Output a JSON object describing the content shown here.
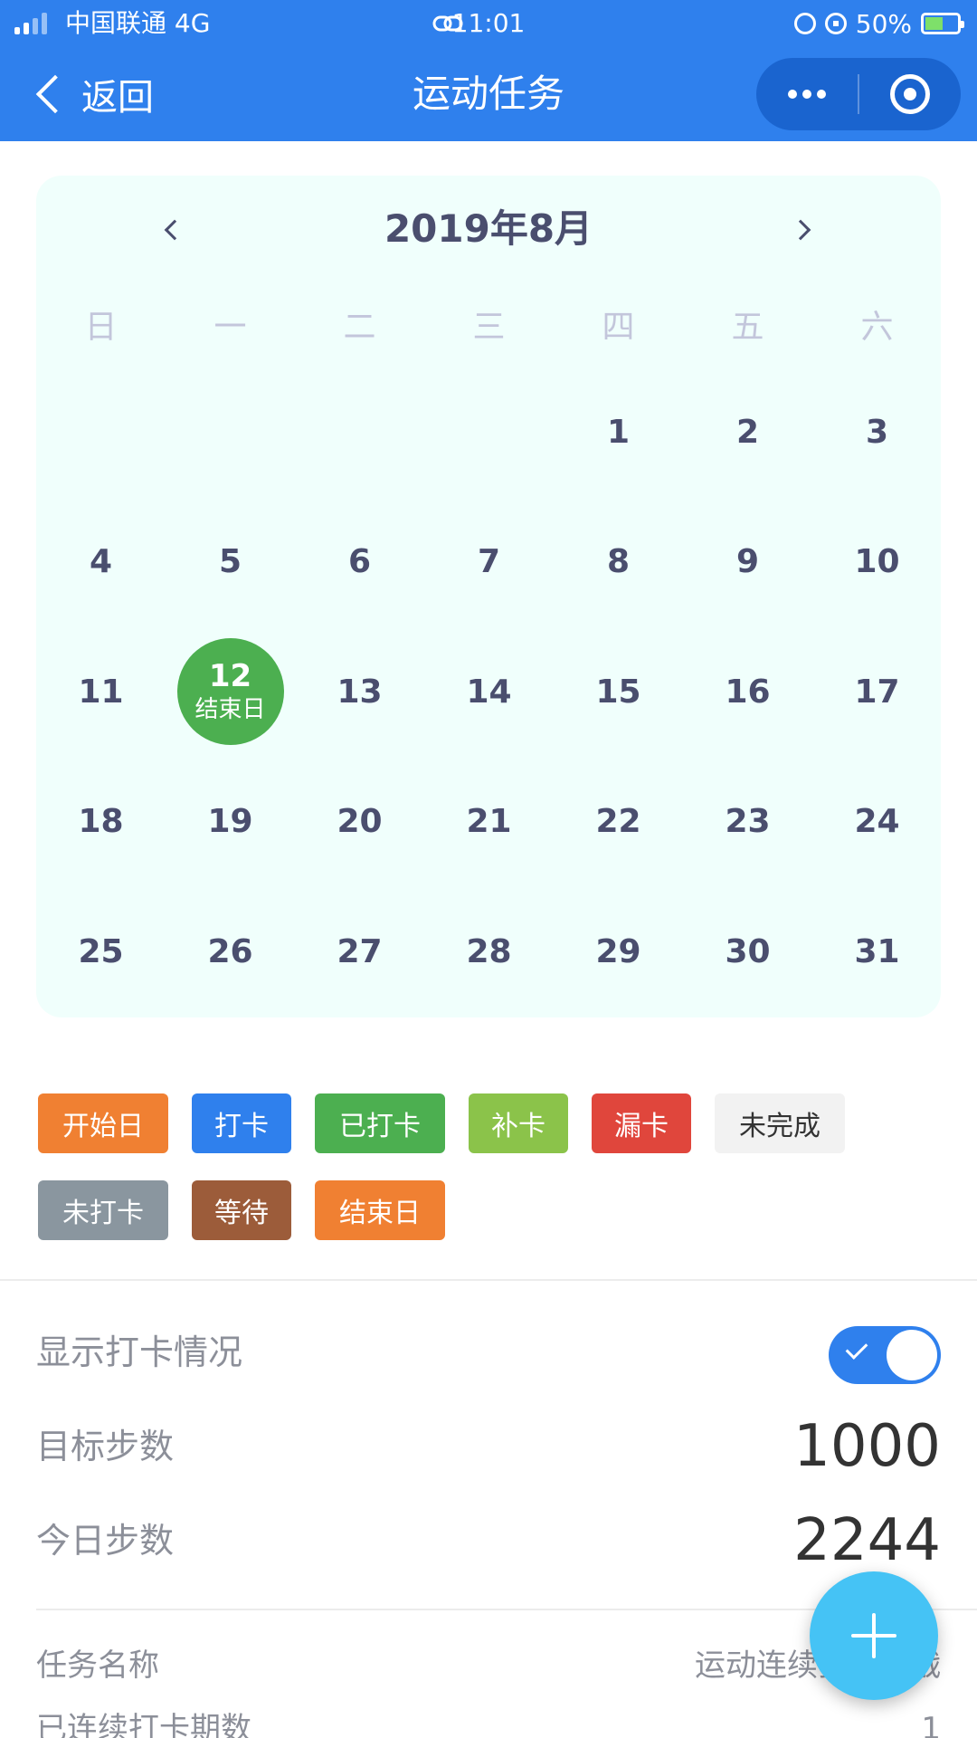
{
  "status_bar": {
    "carrier": "中国联通 4G",
    "time": "11:01",
    "battery": "50%"
  },
  "nav": {
    "back_label": "返回",
    "title": "运动任务"
  },
  "calendar": {
    "title": "2019年8月",
    "weekdays": [
      "日",
      "一",
      "二",
      "三",
      "四",
      "五",
      "六"
    ],
    "days": [
      "1",
      "2",
      "3",
      "4",
      "5",
      "6",
      "7",
      "8",
      "9",
      "10",
      "11",
      "12",
      "13",
      "14",
      "15",
      "16",
      "17",
      "18",
      "19",
      "20",
      "21",
      "22",
      "23",
      "24",
      "25",
      "26",
      "27",
      "28",
      "29",
      "30",
      "31"
    ],
    "special_day": {
      "number": "12",
      "label": "结束日",
      "color": "#4caf50"
    }
  },
  "legend": [
    {
      "label": "开始日",
      "color": "#f08032",
      "text_color": "#ffffff"
    },
    {
      "label": "打卡",
      "color": "#2f80ed",
      "text_color": "#ffffff"
    },
    {
      "label": "已打卡",
      "color": "#4caf50",
      "text_color": "#ffffff"
    },
    {
      "label": "补卡",
      "color": "#8bc34a",
      "text_color": "#ffffff"
    },
    {
      "label": "漏卡",
      "color": "#e0463c",
      "text_color": "#ffffff"
    },
    {
      "label": "未完成",
      "color": "#f2f2f2",
      "text_color": "#333333"
    },
    {
      "label": "未打卡",
      "color": "#8a969f",
      "text_color": "#ffffff"
    },
    {
      "label": "等待",
      "color": "#9c5c3a",
      "text_color": "#ffffff"
    },
    {
      "label": "结束日",
      "color": "#f08032",
      "text_color": "#ffffff"
    }
  ],
  "settings": {
    "show_checkin_label": "显示打卡情况",
    "show_checkin_on": true,
    "target_steps_label": "目标步数",
    "target_steps_value": "1000",
    "today_steps_label": "今日步数",
    "today_steps_value": "2244"
  },
  "details": {
    "task_name_label": "任务名称",
    "task_name_value": "运动连续打卡挑战",
    "streak_label": "已连续打卡期数",
    "streak_value": "1"
  }
}
